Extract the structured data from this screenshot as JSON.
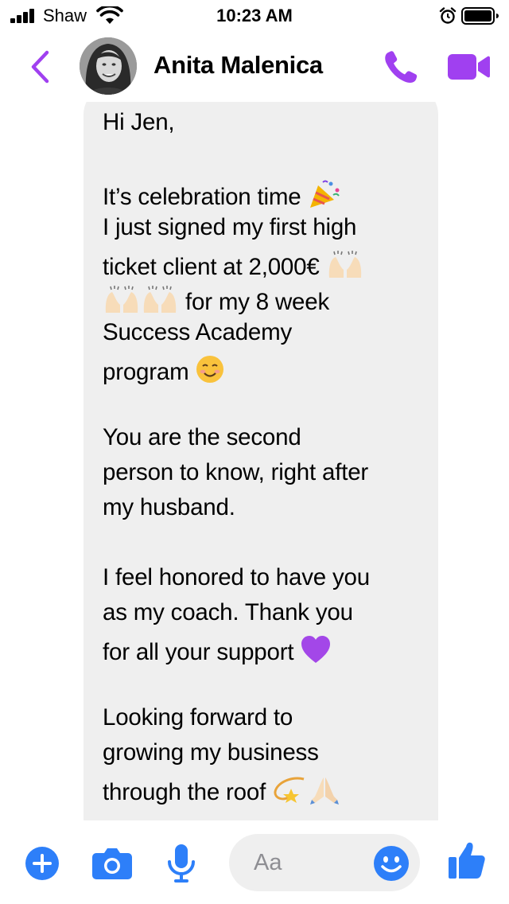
{
  "status_bar": {
    "carrier": "Shaw",
    "time": "10:23 AM"
  },
  "header": {
    "contact_name": "Anita Malenica"
  },
  "colors": {
    "accent": "#a040f0",
    "composer_blue": "#2d7ff9",
    "bubble": "#efefef"
  },
  "message": {
    "lines": [
      "Hi Jen,",
      "It’s celebration time",
      "I just signed my first high",
      "ticket client at 2,000€",
      "for my 8 week",
      "Success Academy",
      "program",
      "You are the second",
      "person to know, right after",
      "my husband.",
      "I feel honored to have you",
      "as my coach. Thank you",
      "for all your support",
      "Looking forward to",
      "growing my business",
      "through the roof"
    ],
    "emojis": [
      "party-popper",
      "raising-hands",
      "smiling-face",
      "purple-heart",
      "dizzy",
      "folded-hands"
    ]
  },
  "composer": {
    "placeholder": "Aa",
    "icons": [
      "plus-icon",
      "camera-icon",
      "microphone-icon",
      "emoji-icon",
      "thumbs-up-icon"
    ]
  }
}
